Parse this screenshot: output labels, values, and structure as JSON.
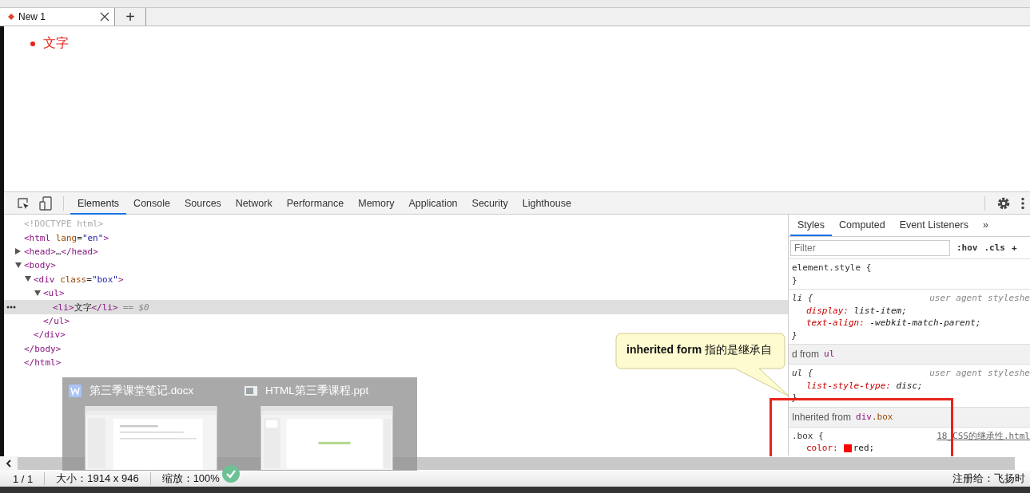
{
  "browser_tabs": [
    {
      "label": "New 1",
      "selected": true
    }
  ],
  "new_tab": "+",
  "page": {
    "list_items": [
      "文字"
    ]
  },
  "devtools": {
    "tabs": [
      {
        "label": "Elements",
        "selected": true
      },
      {
        "label": "Console",
        "selected": false
      },
      {
        "label": "Sources",
        "selected": false
      },
      {
        "label": "Network",
        "selected": false
      },
      {
        "label": "Performance",
        "selected": false
      },
      {
        "label": "Memory",
        "selected": false
      },
      {
        "label": "Application",
        "selected": false
      },
      {
        "label": "Security",
        "selected": false
      },
      {
        "label": "Lighthouse",
        "selected": false
      }
    ],
    "dom": [
      {
        "kind": "doctype",
        "open": "<!DOCTYPE html>",
        "selected": false
      },
      {
        "kind": "element",
        "open": "<html lang=\"en\">",
        "close": "</html>",
        "selected": false,
        "children": [
          {
            "kind": "element",
            "open": "<head>…</head>",
            "expanded": false,
            "selected": false
          },
          {
            "kind": "element",
            "open": "<body>",
            "close": "</body>",
            "expanded": true,
            "selected": false,
            "children": [
              {
                "kind": "element",
                "open": "<div class=\"box\">",
                "close": "</div>",
                "expanded": true,
                "selected": false,
                "children": [
                  {
                    "kind": "element",
                    "open": "<ul>",
                    "close": "</ul>",
                    "expanded": true,
                    "selected": false,
                    "children": [
                      {
                        "kind": "element",
                        "open": "<li>文字</li>",
                        "note": "== $0",
                        "selected": true
                      }
                    ]
                  }
                ]
              }
            ]
          }
        ]
      }
    ],
    "styles": {
      "tabs": [
        {
          "label": "Styles",
          "selected": true
        },
        {
          "label": "Computed",
          "selected": false
        },
        {
          "label": "Event Listeners",
          "selected": false
        },
        {
          "label": "»",
          "selected": false
        }
      ],
      "filter": {
        "placeholder": "Filter"
      },
      "buttons": [
        ":hov",
        ".cls",
        "+"
      ],
      "sections": [
        {
          "kind": "rule",
          "selector": "element.style {",
          "close": "}"
        },
        {
          "kind": "rule",
          "selector": "li {",
          "source": "user agent styleshe",
          "link": false,
          "close": "}",
          "props": [
            {
              "text": "display: list-item;"
            },
            {
              "text": "text-align: -webkit-match-parent;"
            }
          ]
        },
        {
          "kind": "header",
          "label": "d from",
          "element": "ul"
        },
        {
          "kind": "rule",
          "selector": "ul {",
          "source": "user agent styleshe",
          "link": false,
          "close": "}",
          "props": [
            {
              "text": "list-style-type: disc;"
            }
          ]
        },
        {
          "kind": "header",
          "label": "Inherited from",
          "element": "div.box"
        },
        {
          "kind": "rule",
          "selector": ".box {",
          "source": "18_CSS的继承性.html",
          "link": true,
          "props": [
            {
              "text": "color: red;",
              "color": "#ff0000"
            }
          ]
        }
      ]
    }
  },
  "callout": {
    "text": "**inherited form** 指的是继承自"
  },
  "taskbar_preview": {
    "items": [
      {
        "title": "第三季课堂笔记.docx",
        "kind": "doc"
      },
      {
        "title": "HTML第三季课程.ppt",
        "kind": "ppt"
      }
    ]
  },
  "status_bar": {
    "items": [
      "1 / 1",
      "大小：1914 x 946",
      "缩放：100%"
    ],
    "right": "注册给：飞扬时"
  }
}
